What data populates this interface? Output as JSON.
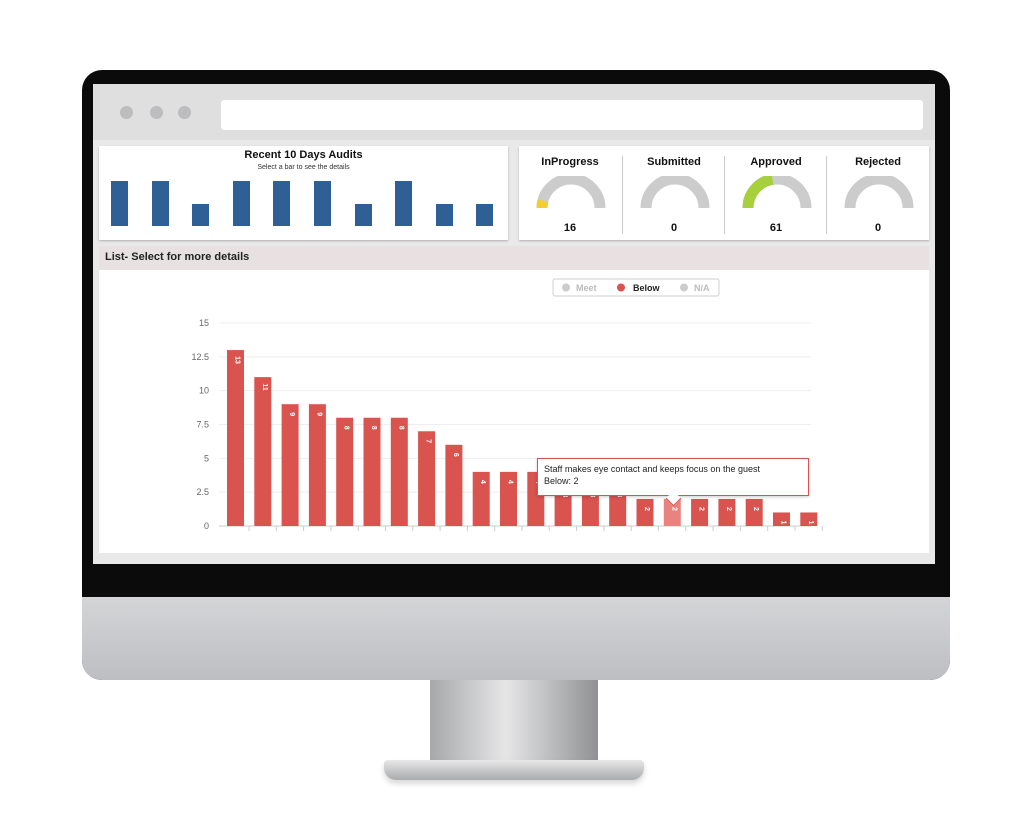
{
  "audits": {
    "title": "Recent 10 Days Audits",
    "subtitle": "Select a bar to see the details",
    "values": [
      5,
      5,
      2.5,
      5,
      5,
      5,
      2.5,
      5,
      2.5,
      2.5
    ]
  },
  "status": [
    {
      "label": "InProgress",
      "value": "16",
      "fill": 0.08,
      "color": "#f2cf2e"
    },
    {
      "label": "Submitted",
      "value": "0",
      "fill": 0,
      "color": "#cccccc"
    },
    {
      "label": "Approved",
      "value": "61",
      "fill": 0.45,
      "color": "#a6d13c"
    },
    {
      "label": "Rejected",
      "value": "0",
      "fill": 0,
      "color": "#cccccc"
    }
  ],
  "list": {
    "header": "List- Select for more details"
  },
  "legend": {
    "meet": "Meet",
    "below": "Below",
    "na": "N/A"
  },
  "tooltip": {
    "line1": "Staff makes eye contact and keeps focus on the guest",
    "line2": "Below: 2"
  },
  "colors": {
    "below": "#d9534f",
    "below_highlight": "#e8837f",
    "audit_bar": "#2e6096",
    "inactive": "#cccccc"
  },
  "chart_data": {
    "type": "bar",
    "title": "",
    "xlabel": "",
    "ylabel": "",
    "ylim": [
      0,
      15
    ],
    "yticks": [
      "0",
      "2.5",
      "5",
      "7.5",
      "10",
      "12.5",
      "15"
    ],
    "series": [
      {
        "name": "Below",
        "values": [
          13,
          11,
          9,
          9,
          8,
          8,
          8,
          7,
          6,
          4,
          4,
          4,
          3,
          3,
          3,
          2,
          2,
          2,
          2,
          2,
          1,
          1
        ]
      }
    ],
    "highlight_index": 16,
    "legend": [
      "Meet",
      "Below",
      "N/A"
    ],
    "legend_position": "top-right",
    "grid": true
  }
}
